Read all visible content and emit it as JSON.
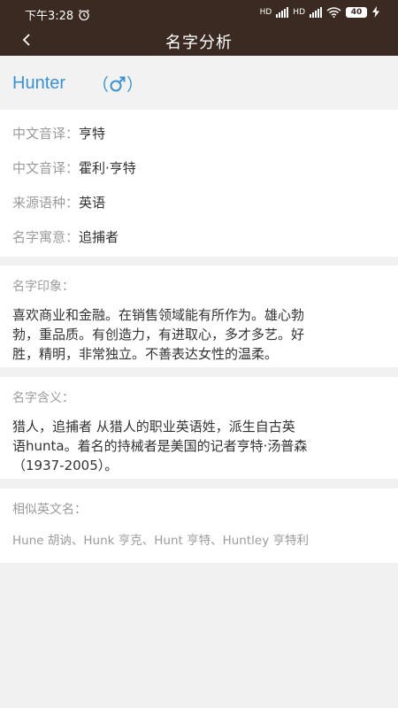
{
  "status_bar": {
    "time": "下午3:28",
    "signal_1": "HD",
    "signal_2": "HD",
    "battery": "40"
  },
  "header": {
    "title": "名字分析",
    "back_icon": "chevron-left-icon"
  },
  "name": {
    "text": "Hunter",
    "gender_open": "（",
    "gender_icon": "male-icon",
    "gender_close": "）"
  },
  "details": [
    {
      "label": "中文音译：",
      "value": "亨特"
    },
    {
      "label": "中文音译：",
      "value": "霍利·亨特"
    },
    {
      "label": "来源语种：",
      "value": "英语"
    },
    {
      "label": "名字寓意：",
      "value": "追捕者"
    }
  ],
  "impression": {
    "label": "名字印象：",
    "lines": [
      "喜欢商业和金融。在销售领域能有所作为。雄心勃",
      "勃，重品质。有创造力，有进取心，多才多艺。好",
      "胜，精明，非常独立。不善表达女性的温柔。"
    ]
  },
  "meaning": {
    "label": "名字含义：",
    "lines": [
      "猎人，追捕者 从猎人的职业英语姓，派生自古英",
      "语hunta。着名的持械者是美国的记者亨特·汤普森",
      "（1937-2005）。"
    ]
  },
  "similar": {
    "label": "相似英文名：",
    "text": "Hune 胡讷、Hunk 亨克、Hunt 亨特、Huntley 亨特利"
  },
  "colors": {
    "header_bg": "#3a2a22",
    "accent_blue": "#3b92d0",
    "page_bg": "#f1f1f1"
  }
}
